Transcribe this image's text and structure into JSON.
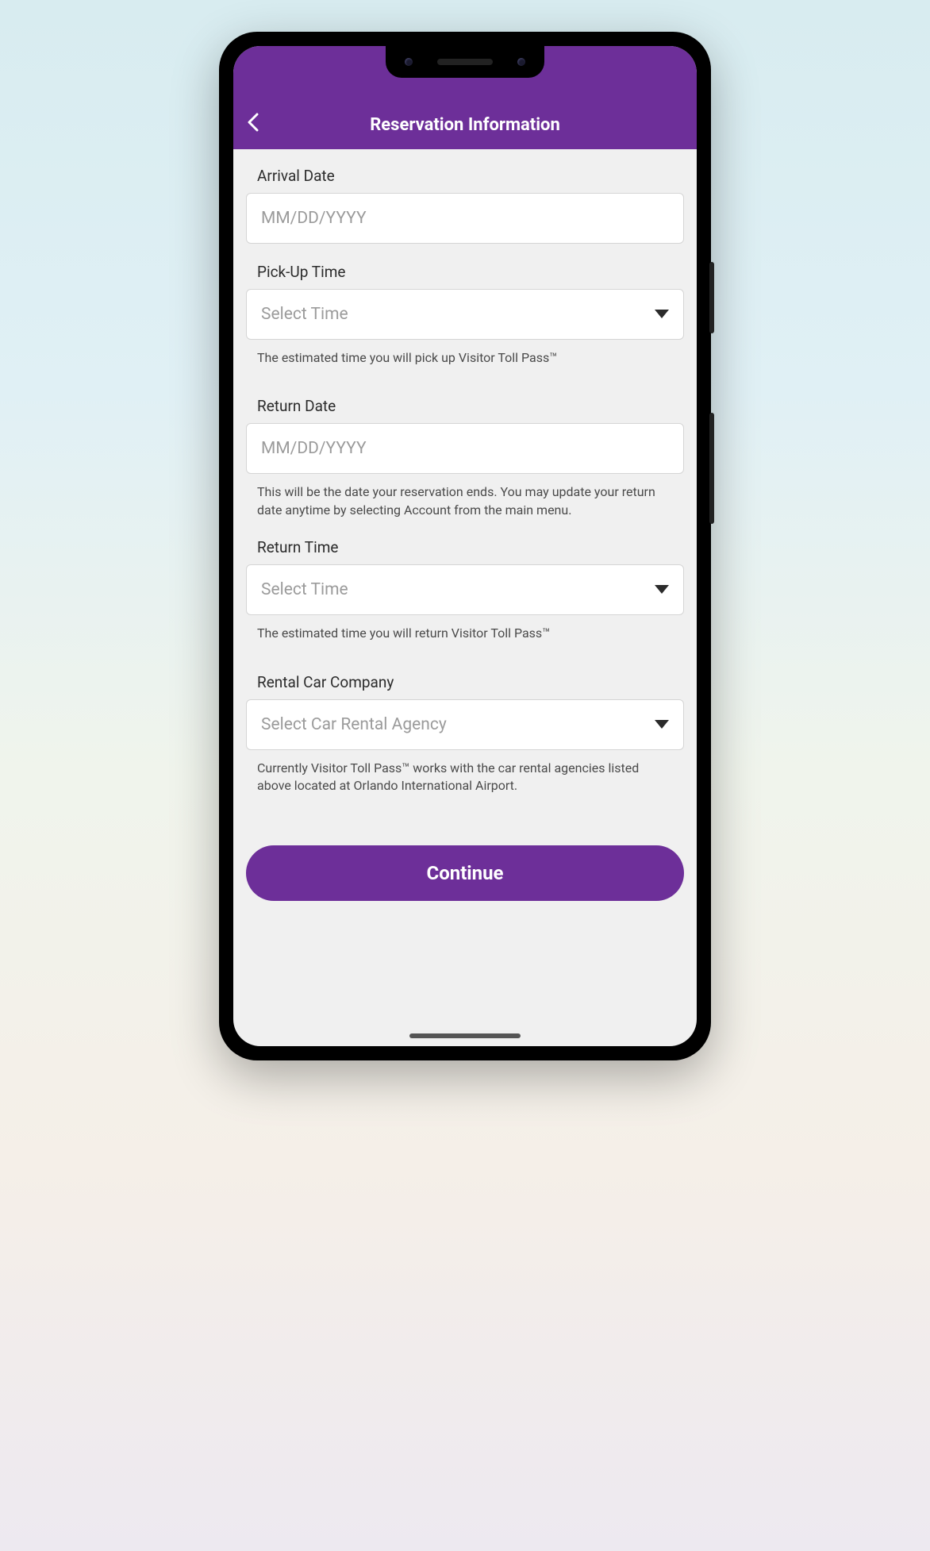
{
  "header": {
    "title": "Reservation Information"
  },
  "form": {
    "arrivalDate": {
      "label": "Arrival Date",
      "placeholder": "MM/DD/YYYY"
    },
    "pickupTime": {
      "label": "Pick-Up Time",
      "placeholder": "Select Time",
      "helper": "The estimated time you will pick up Visitor Toll Pass™"
    },
    "returnDate": {
      "label": "Return Date",
      "placeholder": "MM/DD/YYYY",
      "helper": "This will be the date your reservation ends. You may update your return date anytime by selecting Account from the main menu."
    },
    "returnTime": {
      "label": "Return Time",
      "placeholder": "Select Time",
      "helper": "The estimated time you will return Visitor Toll Pass™"
    },
    "rentalCompany": {
      "label": "Rental Car Company",
      "placeholder": "Select Car Rental Agency",
      "helper": "Currently Visitor Toll Pass™ works with the car rental agencies listed above located at Orlando International Airport."
    }
  },
  "buttons": {
    "continue": "Continue"
  }
}
